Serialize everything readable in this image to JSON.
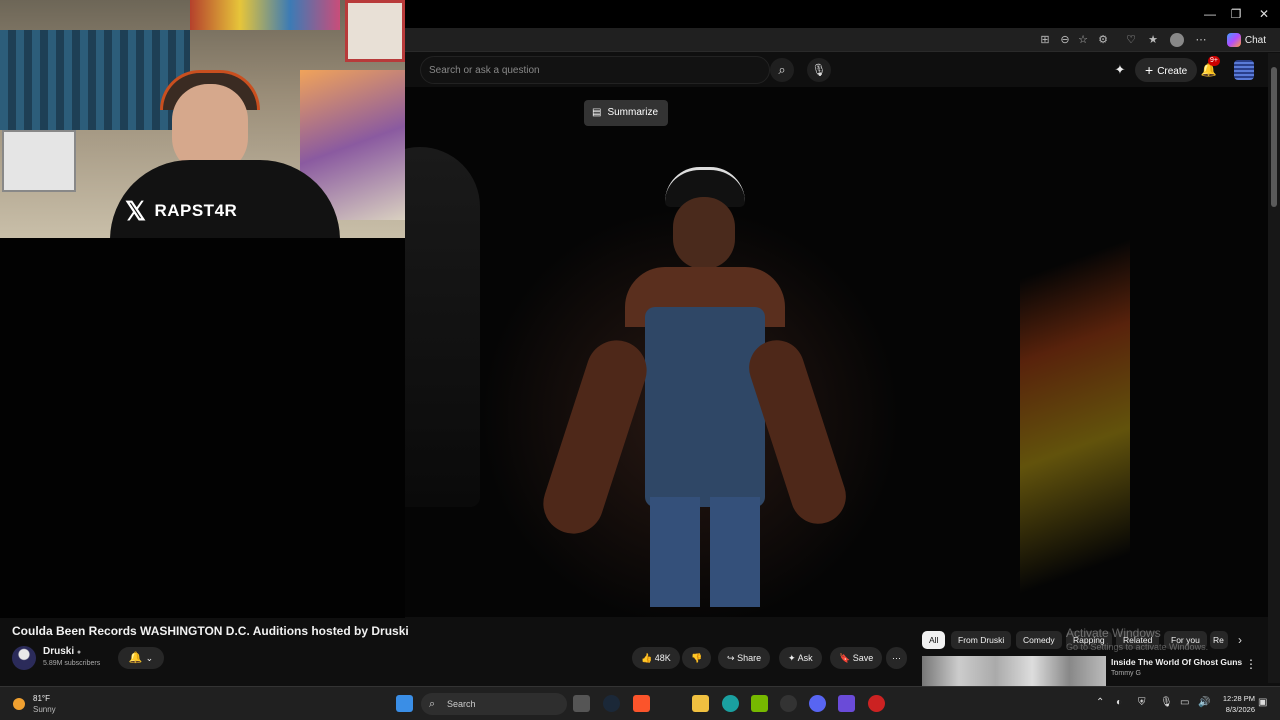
{
  "browser": {
    "chat_label": "Chat"
  },
  "header": {
    "search_placeholder": "Search or ask a question",
    "create_label": "Create",
    "notification_count": "9+"
  },
  "overlay": {
    "streamer_name": "RAPST4R",
    "summarize_label": "Summarize"
  },
  "video": {
    "title": "Coulda Been Records WASHINGTON D.C. Auditions hosted by Druski",
    "channel": "Druski",
    "subscribers": "5.89M subscribers",
    "likes": "48K",
    "share_label": "Share",
    "ask_label": "Ask",
    "save_label": "Save"
  },
  "chips": [
    "All",
    "From Druski",
    "Comedy",
    "Rapping",
    "Related",
    "For you",
    "Re"
  ],
  "watermark": {
    "title": "Activate Windows",
    "subtitle": "Go to Settings to activate Windows."
  },
  "recommendation": {
    "title": "Inside The World Of Ghost Guns",
    "channel": "Tommy G"
  },
  "taskbar": {
    "temperature": "81°F",
    "condition": "Sunny",
    "search_label": "Search",
    "time": "12:28 PM",
    "date": "8/3/2026"
  },
  "colors": {
    "background": "#0f0f0f",
    "button": "#272727",
    "notification_red": "#cc0000"
  }
}
